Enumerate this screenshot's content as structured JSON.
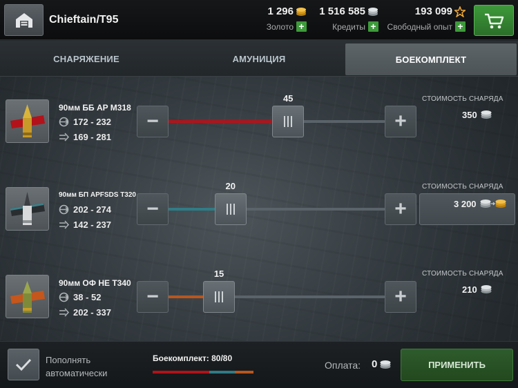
{
  "header": {
    "vehicle_name": "Chieftain/T95",
    "currencies": [
      {
        "value": "1 296",
        "label": "Золото",
        "icon": "gold-coins-icon"
      },
      {
        "value": "1 516 585",
        "label": "Кредиты",
        "icon": "silver-coins-icon"
      },
      {
        "value": "193 099",
        "label": "Свободный опыт",
        "icon": "star-icon"
      }
    ],
    "plus_symbol": "+"
  },
  "tabs": [
    {
      "label": "СНАРЯЖЕНИЕ",
      "active": false
    },
    {
      "label": "АМУНИЦИЯ",
      "active": false
    },
    {
      "label": "БОЕКОМПЛЕКТ",
      "active": true
    }
  ],
  "shells": [
    {
      "name": "90мм ББ AP M318",
      "penetration": "172 - 232",
      "damage": "169 - 281",
      "count": "45",
      "count_value": 45,
      "max": 80,
      "color": "#b3121a",
      "price_label": "СТОИМОСТЬ СНАРЯДА",
      "price": "350",
      "currency": "silver"
    },
    {
      "name": "90мм БП APFSDS T320",
      "penetration": "202 - 274",
      "damage": "142 - 237",
      "count": "20",
      "count_value": 20,
      "max": 80,
      "color": "#2f7c86",
      "price_label": "СТОИМОСТЬ СНАРЯДА",
      "price": "3 200",
      "currency": "silver-or-gold"
    },
    {
      "name": "90мм ОФ HE T340",
      "penetration": "38 - 52",
      "damage": "202 - 337",
      "count": "15",
      "count_value": 15,
      "max": 80,
      "color": "#b9561e",
      "price_label": "СТОИМОСТЬ СНАРЯДА",
      "price": "210",
      "currency": "silver"
    }
  ],
  "footer": {
    "auto_refill_line1": "Пополнять",
    "auto_refill_line2": "автоматически",
    "ammo_label": "Боекомплект: 80/80",
    "payment_label": "Оплата:",
    "payment_value": "0",
    "apply_label": "ПРИМЕНИТЬ"
  }
}
